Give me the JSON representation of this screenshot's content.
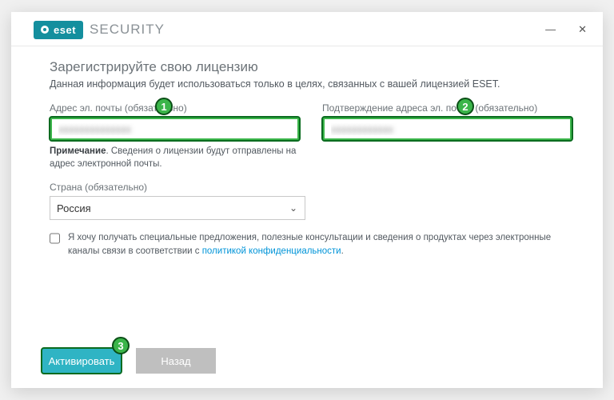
{
  "brand": {
    "logo_text": "eset",
    "subtitle": "SECURITY"
  },
  "page": {
    "title": "Зарегистрируйте свою лицензию",
    "description": "Данная информация будет использоваться только в целях, связанных с вашей лицензией ESET."
  },
  "fields": {
    "email": {
      "label": "Адрес эл. почты (обязательно)",
      "value": "xxxxxxxxxxxxxx"
    },
    "email_confirm": {
      "label": "Подтверждение адреса эл. почты (обязательно)",
      "value": "xxxxxxxxxxxx"
    },
    "note_bold": "Примечание",
    "note_text": ". Сведения о лицензии будут отправлены на адрес электронной почты.",
    "country": {
      "label": "Страна (обязательно)",
      "value": "Россия"
    }
  },
  "consent": {
    "text_before": "Я хочу получать специальные предложения, полезные консультации и сведения о продуктах через электронные каналы связи в соответствии с ",
    "link_text": "политикой конфиденциальности",
    "text_after": "."
  },
  "buttons": {
    "activate": "Активировать",
    "back": "Назад"
  },
  "callouts": {
    "c1": "1",
    "c2": "2",
    "c3": "3"
  }
}
